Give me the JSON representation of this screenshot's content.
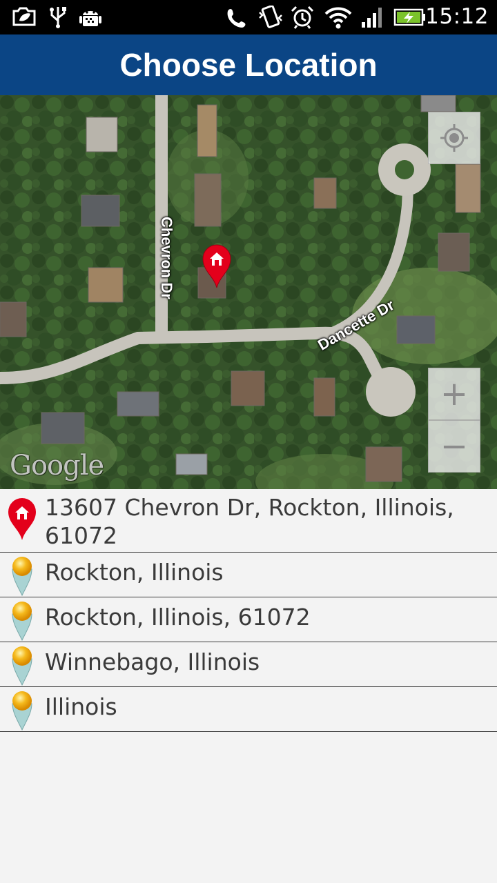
{
  "status_bar": {
    "time": "15:12",
    "icons": [
      "screenshot-icon",
      "usb-icon",
      "android-debug-icon",
      "phone-icon",
      "vibrate-icon",
      "alarm-icon",
      "wifi-icon",
      "signal-icon",
      "battery-charging-icon"
    ]
  },
  "header": {
    "title": "Choose Location"
  },
  "map": {
    "streets": {
      "street_1": "Chevron Dr",
      "street_2": "Dancette Dr"
    },
    "attribution": "Google",
    "controls": {
      "zoom_in": "+",
      "zoom_out": "−"
    }
  },
  "locations": {
    "items": [
      {
        "text": "13607 Chevron Dr, Rockton, Illinois, 61072",
        "pin": "red-home-pin-icon"
      },
      {
        "text": "Rockton, Illinois",
        "pin": "yellow-pin-icon"
      },
      {
        "text": "Rockton, Illinois, 61072",
        "pin": "yellow-pin-icon"
      },
      {
        "text": "Winnebago, Illinois",
        "pin": "yellow-pin-icon"
      },
      {
        "text": "Illinois",
        "pin": "yellow-pin-icon"
      }
    ]
  },
  "colors": {
    "header_bg": "#0b4585",
    "list_bg": "#f3f3f3",
    "text": "#3a3a3a",
    "home_pin": "#e3001b"
  }
}
